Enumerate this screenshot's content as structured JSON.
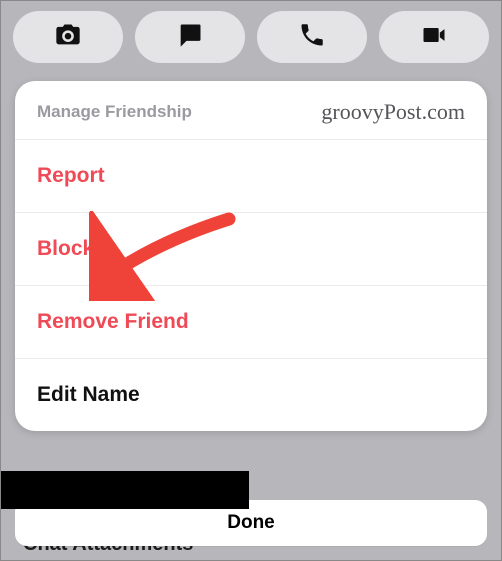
{
  "toolbar": {
    "camera": "camera",
    "chat": "chat",
    "call": "call",
    "video": "video"
  },
  "sheet": {
    "title": "Manage Friendship",
    "watermark": "groovyPost.com",
    "options": {
      "report": "Report",
      "block": "Block",
      "remove": "Remove Friend",
      "edit": "Edit Name"
    }
  },
  "done": "Done",
  "background_partial": "Chat Attachments"
}
